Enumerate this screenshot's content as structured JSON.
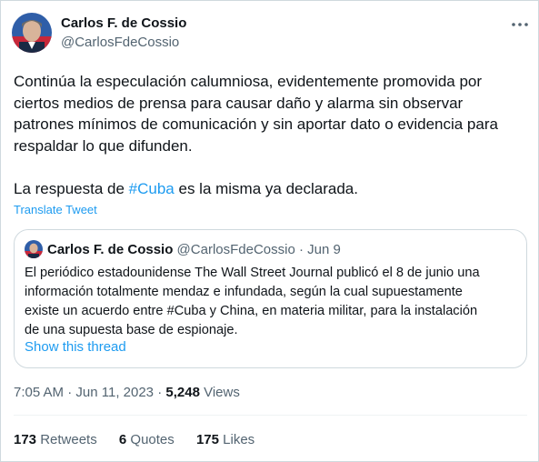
{
  "author": {
    "name": "Carlos F. de Cossio",
    "handle": "@CarlosFdeCossio"
  },
  "tweet": {
    "lines": [
      "Continúa la especulación calumniosa, evidentemente promovida por",
      "ciertos medios de prensa para causar daño y alarma sin observar",
      "patrones mínimos de comunicación y sin aportar dato o evidencia para",
      "respaldar lo que difunden."
    ],
    "last_pre": "La respuesta de ",
    "last_hashtag": "#Cuba",
    "last_post": " es la misma ya declarada.",
    "translate_label": "Translate Tweet"
  },
  "quoted": {
    "name": "Carlos F. de Cossio",
    "handle": "@CarlosFdeCossio",
    "separator": " · ",
    "date": "Jun 9",
    "lines": [
      "El periódico estadounidense The Wall Street Journal publicó el 8 de junio una",
      "información totalmente mendaz e infundada, según la cual supuestamente",
      "existe un acuerdo entre #Cuba  y China, en materia militar, para la instalación",
      "de una supuesta base de espionaje."
    ],
    "show_thread": "Show this thread"
  },
  "meta": {
    "time": "7:05 AM",
    "separator": " · ",
    "date": "Jun 11, 2023",
    "views_count": "5,248",
    "views_label": " Views"
  },
  "stats": {
    "retweets_count": "173",
    "retweets_label": " Retweets",
    "quotes_count": "6",
    "quotes_label": " Quotes",
    "likes_count": "175",
    "likes_label": " Likes"
  },
  "icons": {
    "more": "more-horizontal-icon"
  },
  "colors": {
    "link": "#1d9bf0",
    "secondary_text": "#536471",
    "border": "#cfd9de"
  }
}
